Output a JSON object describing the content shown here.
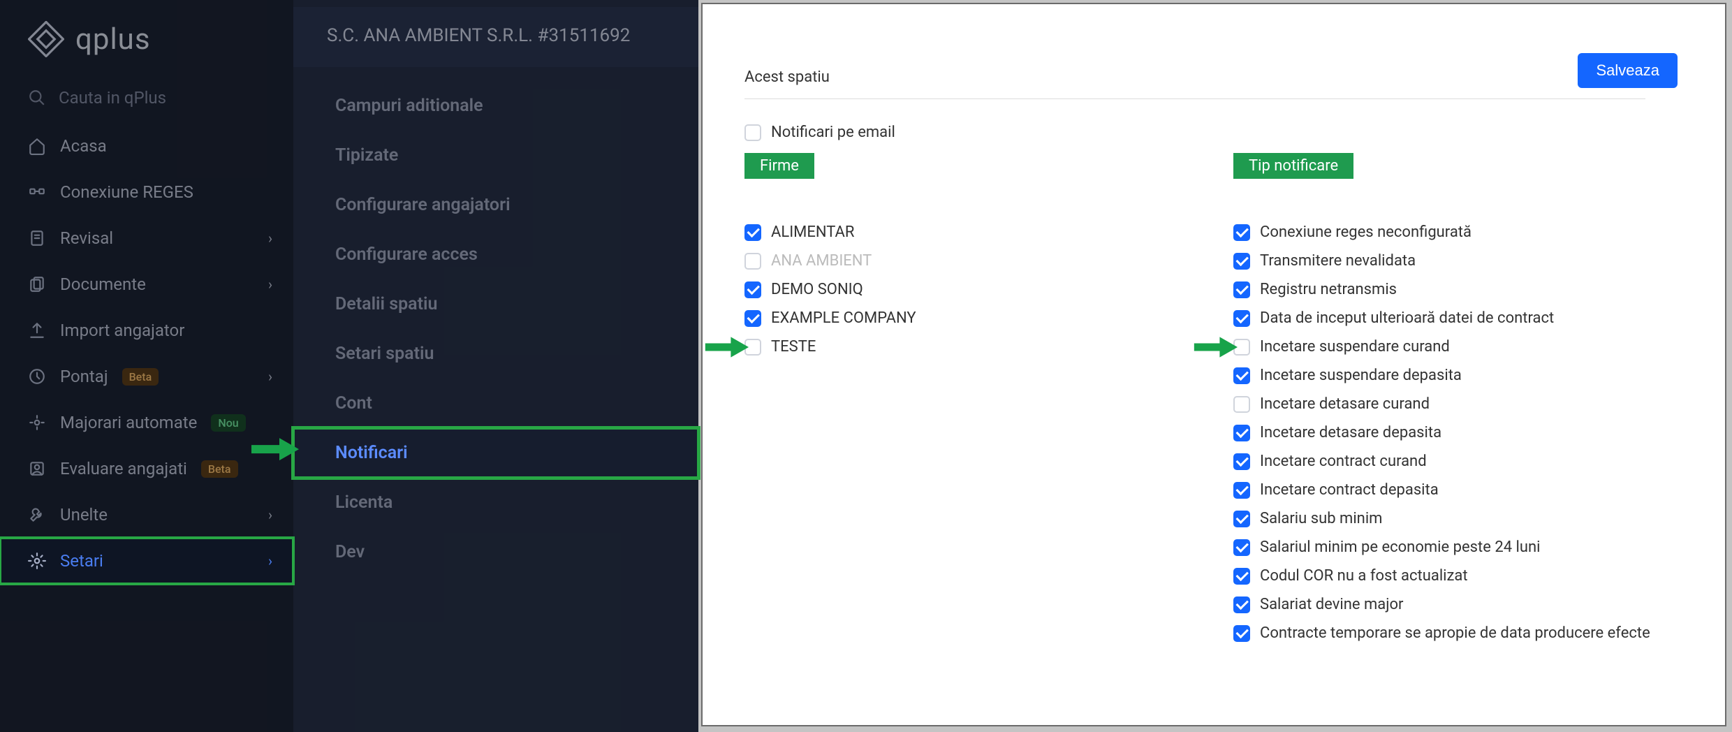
{
  "brand": "qplus",
  "search": {
    "placeholder": "Cauta in qPlus"
  },
  "sidebar": {
    "items": [
      {
        "icon": "home",
        "label": "Acasa",
        "chevron": false
      },
      {
        "icon": "link",
        "label": "Conexiune REGES",
        "chevron": false
      },
      {
        "icon": "file",
        "label": "Revisal",
        "chevron": true
      },
      {
        "icon": "docs",
        "label": "Documente",
        "chevron": true
      },
      {
        "icon": "upload",
        "label": "Import angajator",
        "chevron": false
      },
      {
        "icon": "clock",
        "label": "Pontaj",
        "badge": "Beta",
        "badgeType": "beta",
        "chevron": true
      },
      {
        "icon": "sliders",
        "label": "Majorari automate",
        "badge": "Nou",
        "badgeType": "nou",
        "chevron": false
      },
      {
        "icon": "user",
        "label": "Evaluare angajati",
        "badge": "Beta",
        "badgeType": "beta",
        "chevron": false
      },
      {
        "icon": "wrench",
        "label": "Unelte",
        "chevron": true
      },
      {
        "icon": "gear",
        "label": "Setari",
        "chevron": true,
        "active": true,
        "highlight": true
      }
    ]
  },
  "subsidebar": {
    "company": "S.C. ANA AMBIENT S.R.L. #31511692",
    "items": [
      {
        "label": "Campuri aditionale"
      },
      {
        "label": "Tipizate"
      },
      {
        "label": "Configurare angajatori"
      },
      {
        "label": "Configurare acces"
      },
      {
        "label": "Detalii spatiu"
      },
      {
        "label": "Setari spatiu"
      },
      {
        "label": "Cont"
      },
      {
        "label": "Notificari",
        "active": true,
        "arrow": true
      },
      {
        "label": "Licenta"
      },
      {
        "label": "Dev"
      }
    ]
  },
  "panel": {
    "save_label": "Salveaza",
    "section_title": "Acest spatiu",
    "email_notif": {
      "label": "Notificari pe email",
      "checked": false
    },
    "col_firme": {
      "header": "Firme",
      "items": [
        {
          "label": "ALIMENTAR",
          "checked": true
        },
        {
          "label": "ANA AMBIENT",
          "checked": false,
          "muted": true
        },
        {
          "label": "DEMO SONIQ",
          "checked": true
        },
        {
          "label": "EXAMPLE COMPANY",
          "checked": true
        },
        {
          "label": "TESTE",
          "checked": false,
          "arrow": true
        }
      ]
    },
    "col_tip": {
      "header": "Tip notificare",
      "items": [
        {
          "label": "Conexiune reges neconfigurată",
          "checked": true
        },
        {
          "label": "Transmitere nevalidata",
          "checked": true
        },
        {
          "label": "Registru netransmis",
          "checked": true
        },
        {
          "label": "Data de inceput ulterioară datei de contract",
          "checked": true
        },
        {
          "label": "Incetare suspendare curand",
          "checked": false,
          "arrow": true
        },
        {
          "label": "Incetare suspendare depasita",
          "checked": true
        },
        {
          "label": "Incetare detasare curand",
          "checked": false
        },
        {
          "label": "Incetare detasare depasita",
          "checked": true
        },
        {
          "label": "Incetare contract curand",
          "checked": true
        },
        {
          "label": "Incetare contract depasita",
          "checked": true
        },
        {
          "label": "Salariu sub minim",
          "checked": true
        },
        {
          "label": "Salariul minim pe economie peste 24 luni",
          "checked": true
        },
        {
          "label": "Codul COR nu a fost actualizat",
          "checked": true
        },
        {
          "label": "Salariat devine major",
          "checked": true
        },
        {
          "label": "Contracte temporare se apropie de data producere efecte",
          "checked": true
        }
      ]
    }
  }
}
